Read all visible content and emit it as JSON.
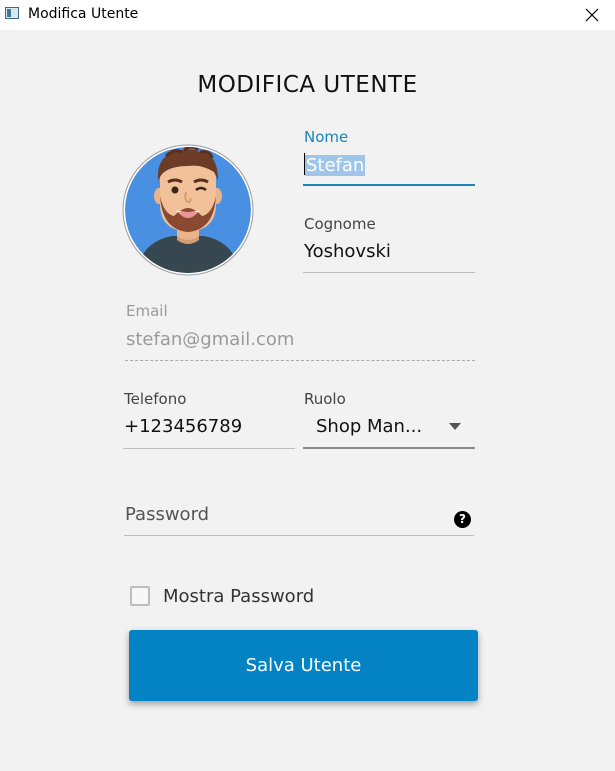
{
  "window": {
    "title": "Modifica Utente",
    "close_icon": "close-icon"
  },
  "form": {
    "heading": "MODIFICA UTENTE",
    "avatar_icon": "user-avatar",
    "nome": {
      "label": "Nome",
      "value": "Stefan"
    },
    "cognome": {
      "label": "Cognome",
      "value": "Yoshovski"
    },
    "email": {
      "label": "Email",
      "value": "stefan@gmail.com"
    },
    "telefono": {
      "label": "Telefono",
      "value": "+123456789"
    },
    "ruolo": {
      "label": "Ruolo",
      "value": "Shop Man..."
    },
    "password": {
      "placeholder": "Password",
      "help_icon": "question-circle-icon",
      "help_glyph": "?"
    },
    "show_password": {
      "label": "Mostra Password",
      "checked": false
    },
    "save_label": "Salva Utente"
  },
  "colors": {
    "accent": "#1a86b8",
    "button": "#0382c4",
    "background": "#f2f2f2",
    "avatar_bg": "#4a90e2"
  }
}
